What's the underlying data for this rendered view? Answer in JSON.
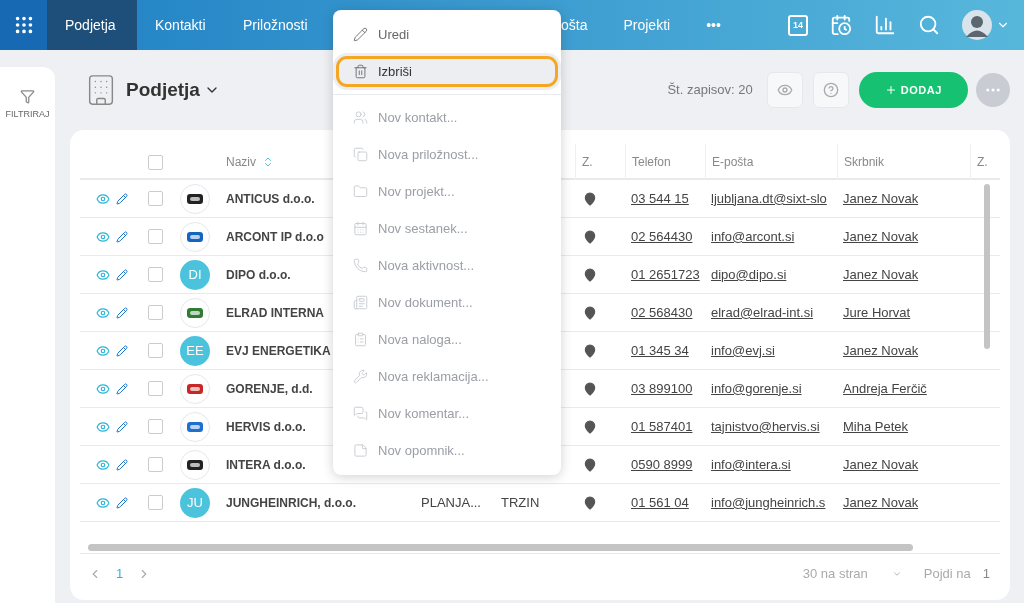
{
  "nav": {
    "tabs": [
      {
        "label": "Podjetja",
        "selected": true
      },
      {
        "label": "Kontakti",
        "selected": false
      },
      {
        "label": "Priložnosti",
        "selected": false
      },
      {
        "label": "ošta",
        "selected": false
      },
      {
        "label": "Projekti",
        "selected": false
      },
      {
        "label": "•••",
        "selected": false
      }
    ],
    "calendar_day": "14"
  },
  "sidebar": {
    "filter_label": "FILTRIRAJ"
  },
  "header": {
    "title": "Podjetja",
    "record_count": "Št. zapisov: 20",
    "add_button": "DODAJ"
  },
  "table": {
    "select_all_checked": false,
    "columns": [
      "Naziv",
      "Z.",
      "Telefon",
      "E-pošta",
      "Skrbnik",
      "Z."
    ],
    "rows": [
      {
        "checked": false,
        "name": "ANTICUS d.o.o.",
        "logo": {
          "kind": "logo"
        },
        "phone": "03 544 15",
        "email": "ljubljana.dt@sixt-slo",
        "owner": "Janez Novak"
      },
      {
        "checked": false,
        "name": "ARCONT IP d.o.o",
        "logo": {
          "kind": "logo"
        },
        "phone": "02 564430",
        "email": "info@arcont.si",
        "owner": "Janez Novak"
      },
      {
        "checked": false,
        "name": "DIPO d.o.o.",
        "logo": {
          "kind": "avatar",
          "initials": "DI"
        },
        "phone": "01 2651723",
        "email": "dipo@dipo.si",
        "owner": "Janez Novak"
      },
      {
        "checked": false,
        "name": "ELRAD INTERNA",
        "logo": {
          "kind": "logo"
        },
        "phone": "02 568430",
        "email": "elrad@elrad-int.si",
        "owner": "Jure Horvat"
      },
      {
        "checked": false,
        "name": "EVJ ENERGETIKA",
        "logo": {
          "kind": "avatar",
          "initials": "EE"
        },
        "phone": "01 345 34",
        "email": "info@evj.si",
        "owner": "Janez Novak"
      },
      {
        "checked": false,
        "name": "GORENJE, d.d.",
        "logo": {
          "kind": "logo"
        },
        "phone": "03 899100",
        "email": "info@gorenje.si",
        "owner": "Andreja Ferčič"
      },
      {
        "checked": false,
        "name": "HERVIS d.o.o.",
        "logo": {
          "kind": "logo"
        },
        "phone": "01 587401",
        "email": "tajnistvo@hervis.si",
        "owner": "Miha Petek"
      },
      {
        "checked": false,
        "name": "INTERA d.o.o.",
        "logo": {
          "kind": "logo"
        },
        "phone": "0590 8999",
        "email": "info@intera.si",
        "owner": "Janez Novak"
      },
      {
        "checked": false,
        "name": "JUNGHEINRICH, d.o.o.",
        "logo": {
          "kind": "avatar",
          "initials": "JU"
        },
        "column_5": "PLANJA...",
        "column_6": "TRZIN",
        "phone": "01 561 04",
        "email": "info@jungheinrich.s",
        "owner": "Janez Novak"
      }
    ]
  },
  "pagination": {
    "page": "1",
    "per_page": "30 na stran",
    "goto_label": "Pojdi na",
    "goto_value": "1"
  },
  "context_menu": {
    "items": [
      {
        "label": "Uredi",
        "disabled": false,
        "selected": false
      },
      {
        "label": "Izbriši",
        "disabled": false,
        "selected": true
      },
      {
        "label": "Nov kontakt...",
        "disabled": true,
        "selected": false
      },
      {
        "label": "Nova priložnost...",
        "disabled": true,
        "selected": false
      },
      {
        "label": "Nov projekt...",
        "disabled": true,
        "selected": false
      },
      {
        "label": "Nov sestanek...",
        "disabled": true,
        "selected": false
      },
      {
        "label": "Nova aktivnost...",
        "disabled": true,
        "selected": false
      },
      {
        "label": "Nov dokument...",
        "disabled": true,
        "selected": false
      },
      {
        "label": "Nova naloga...",
        "disabled": true,
        "selected": false
      },
      {
        "label": "Nova reklamacija...",
        "disabled": true,
        "selected": false
      },
      {
        "label": "Nov komentar...",
        "disabled": true,
        "selected": false
      },
      {
        "label": "Nov opomnik...",
        "disabled": true,
        "selected": false
      }
    ]
  }
}
